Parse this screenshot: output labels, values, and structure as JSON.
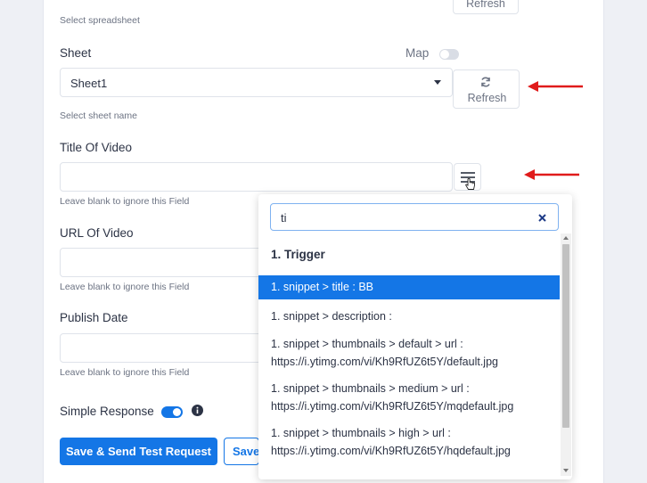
{
  "form": {
    "top_refresh_label": "Refresh",
    "spreadsheet_help": "Select spreadsheet",
    "sheet_label": "Sheet",
    "map_label": "Map",
    "sheet_value": "Sheet1",
    "sheet_refresh_label": "Refresh",
    "sheet_help": "Select sheet name",
    "title_label": "Title Of Video",
    "title_help": "Leave blank to ignore this Field",
    "url_label": "URL Of Video",
    "url_help": "Leave blank to ignore this Field",
    "publish_label": "Publish Date",
    "publish_help": "Leave blank to ignore this Field",
    "simple_response_label": "Simple Response",
    "simple_response_enabled": true,
    "map_enabled": false
  },
  "buttons": {
    "save_send": "Save & Send Test Request",
    "save": "Save"
  },
  "dropdown": {
    "search_value": "ti",
    "group_title": "1. Trigger",
    "items": [
      {
        "label": "1. snippet > title : BB",
        "active": true
      },
      {
        "label": "1. snippet > description :",
        "active": false
      },
      {
        "label": "1. snippet > thumbnails > default > url :",
        "line2": "https://i.ytimg.com/vi/Kh9RfUZ6t5Y/default.jpg",
        "active": false
      },
      {
        "label": "1. snippet > thumbnails > medium > url :",
        "line2": "https://i.ytimg.com/vi/Kh9RfUZ6t5Y/mqdefault.jpg",
        "active": false
      },
      {
        "label": "1. snippet > thumbnails > high > url :",
        "line2": "https://i.ytimg.com/vi/Kh9RfUZ6t5Y/hqdefault.jpg",
        "active": false
      }
    ]
  },
  "colors": {
    "accent": "#1476e6",
    "annotation_arrow": "#e01b1b"
  },
  "icons": [
    "refresh-icon",
    "caret-down-icon",
    "menu-lines-icon",
    "cursor-hand-icon",
    "clear-icon",
    "info-icon",
    "arrow-annotation"
  ]
}
